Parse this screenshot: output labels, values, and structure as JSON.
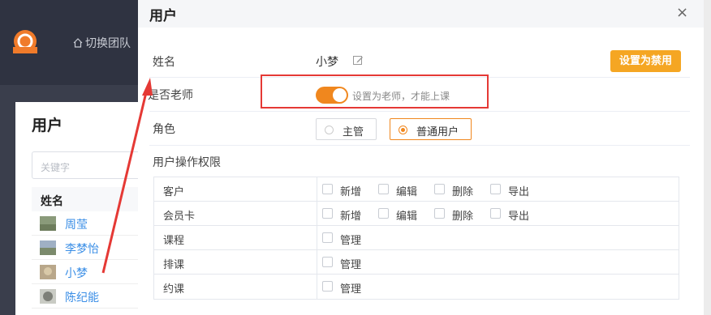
{
  "app": {
    "switch_team_label": "切换团队"
  },
  "users_panel": {
    "title": "用户",
    "search_placeholder": "关键字",
    "column_name": "姓名",
    "users": [
      {
        "name": "周莹"
      },
      {
        "name": "李梦怡"
      },
      {
        "name": "小梦"
      },
      {
        "name": "陈纪能"
      }
    ]
  },
  "modal": {
    "title": "用户",
    "close_label": "×",
    "name_label": "姓名",
    "name_value": "小梦",
    "ban_button": "设置为禁用",
    "is_teacher_label": "是否老师",
    "is_teacher_on": true,
    "is_teacher_hint": "设置为老师，才能上课",
    "role_label": "角色",
    "roles": [
      {
        "label": "主管",
        "selected": false
      },
      {
        "label": "普通用户",
        "selected": true
      }
    ],
    "permissions_title": "用户操作权限",
    "permissions": [
      {
        "name": "客户",
        "options": [
          "新增",
          "编辑",
          "删除",
          "导出"
        ]
      },
      {
        "name": "会员卡",
        "options": [
          "新增",
          "编辑",
          "删除",
          "导出"
        ]
      },
      {
        "name": "课程",
        "options": [
          "管理"
        ]
      },
      {
        "name": "排课",
        "options": [
          "管理"
        ]
      },
      {
        "name": "约课",
        "options": [
          "管理"
        ]
      }
    ]
  },
  "colors": {
    "accent": "#f0871e",
    "ban_button": "#f5a623",
    "annotation_red": "#e53935",
    "link_blue": "#3a8ee6"
  }
}
